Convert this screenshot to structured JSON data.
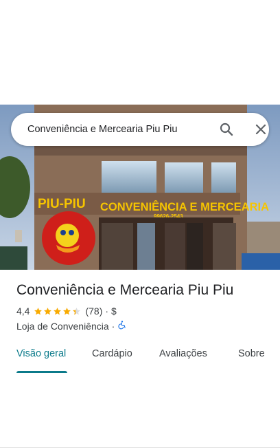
{
  "search": {
    "query": "Conveniência e Mercearia Piu Piu"
  },
  "photo": {
    "sign_brand": "PIU-PIU",
    "sign_name": "CONVENIÊNCIA E MERCEARIA",
    "sign_phone": "99626-2543"
  },
  "place": {
    "title": "Conveniência e Mercearia Piu Piu",
    "rating": "4,4",
    "stars_value": 4.4,
    "reviews": "(78)",
    "separator": "·",
    "price": "$",
    "category": "Loja de Conveniência",
    "accessibility_icon": "wheelchair-icon"
  },
  "tabs": [
    {
      "label": "Visão geral"
    },
    {
      "label": "Cardápio"
    },
    {
      "label": "Avaliações"
    },
    {
      "label": "Sobre"
    }
  ],
  "colors": {
    "accent": "#0b7a8a",
    "star": "#f9ab00",
    "accessibility": "#1a73e8"
  }
}
